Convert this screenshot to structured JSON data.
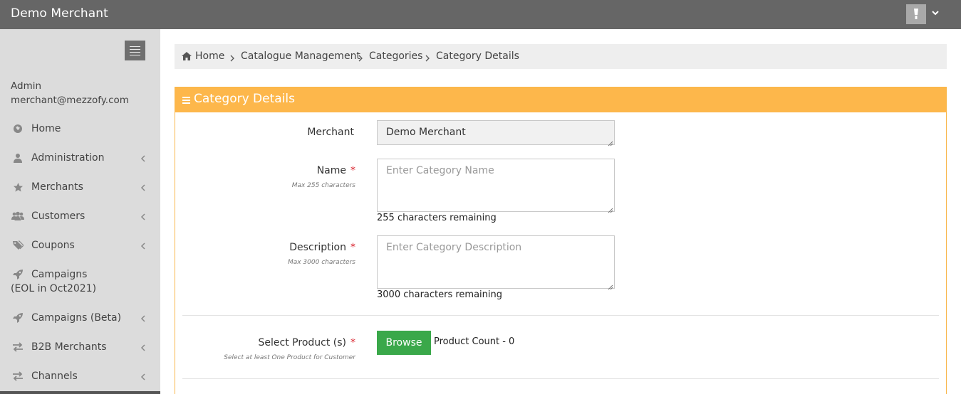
{
  "app": {
    "title": "Demo Merchant"
  },
  "header": {
    "user_icon": "user-badge-icon",
    "menu_icon": "chevron-down-icon"
  },
  "sidebar": {
    "user_role": "Admin",
    "user_email": "merchant@mezzofy.com",
    "items": [
      {
        "label": "Home",
        "icon": "globe-icon",
        "has_submenu": false
      },
      {
        "label": "Administration",
        "icon": "user-icon",
        "has_submenu": true
      },
      {
        "label": "Merchants",
        "icon": "star-icon",
        "has_submenu": true
      },
      {
        "label": "Customers",
        "icon": "users-icon",
        "has_submenu": true
      },
      {
        "label": "Coupons",
        "icon": "tags-icon",
        "has_submenu": true
      },
      {
        "label": "Campaigns",
        "label2": "(EOL in Oct2021)",
        "icon": "rocket-icon",
        "has_submenu": false
      },
      {
        "label": "Campaigns (Beta)",
        "icon": "rocket-icon",
        "has_submenu": true
      },
      {
        "label": "B2B Merchants",
        "icon": "exchange-icon",
        "has_submenu": true
      },
      {
        "label": "Channels",
        "icon": "exchange-icon",
        "has_submenu": true
      }
    ]
  },
  "breadcrumb": {
    "items": [
      "Home",
      "Catalogue Management",
      "Categories",
      "Category Details"
    ],
    "home_icon": "home-icon"
  },
  "panel": {
    "title": "Category Details",
    "title_icon": "menu-bars-icon"
  },
  "form": {
    "merchant": {
      "label": "Merchant",
      "value": "Demo Merchant"
    },
    "name": {
      "label": "Name",
      "required": "*",
      "hint": "Max 255 characters",
      "placeholder": "Enter Category Name",
      "remaining": "255 characters remaining"
    },
    "description": {
      "label": "Description",
      "required": "*",
      "hint": "Max 3000 characters",
      "placeholder": "Enter Category Description",
      "remaining": "3000 characters remaining"
    },
    "products": {
      "label": "Select Product (s)",
      "required": "*",
      "hint": "Select at least One Product for Customer",
      "browse_label": "Browse",
      "count_text": "Product Count - 0"
    }
  },
  "colors": {
    "topbar": "#666666",
    "sidebar": "#dcdcdc",
    "panel_header": "#fdb74b",
    "browse_button": "#3aa84a",
    "required": "#d9232d"
  }
}
